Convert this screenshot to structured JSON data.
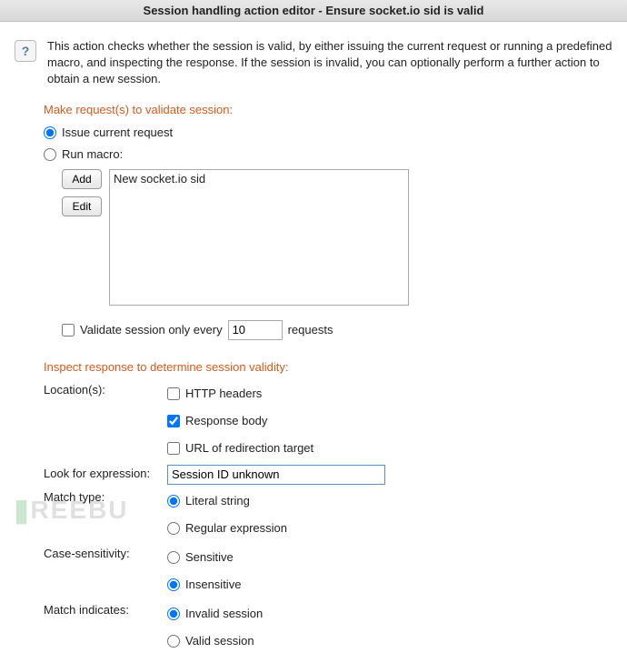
{
  "title": "Session handling action editor - Ensure socket.io sid is valid",
  "description": "This action checks whether the session is valid, by either issuing the current request or running a predefined macro, and inspecting the response. If the session is invalid, you can optionally perform a further action to obtain a new session.",
  "section1": {
    "heading": "Make request(s) to validate session:",
    "issue_label": "Issue current request",
    "run_macro_label": "Run macro:",
    "add_label": "Add",
    "edit_label": "Edit",
    "macro_item": "New socket.io sid",
    "validate_only_label": "Validate session only every",
    "validate_value": "10",
    "validate_suffix": "requests"
  },
  "section2": {
    "heading": "Inspect response to determine session validity:",
    "locations_label": "Location(s):",
    "loc_headers": "HTTP headers",
    "loc_body": "Response body",
    "loc_redirect": "URL of redirection target",
    "expr_label": "Look for expression:",
    "expr_value": "Session ID unknown",
    "match_type_label": "Match type:",
    "mt_literal": "Literal string",
    "mt_regex": "Regular expression",
    "case_label": "Case-sensitivity:",
    "cs_sensitive": "Sensitive",
    "cs_insensitive": "Insensitive",
    "indicates_label": "Match indicates:",
    "mi_invalid": "Invalid session",
    "mi_valid": "Valid session"
  }
}
